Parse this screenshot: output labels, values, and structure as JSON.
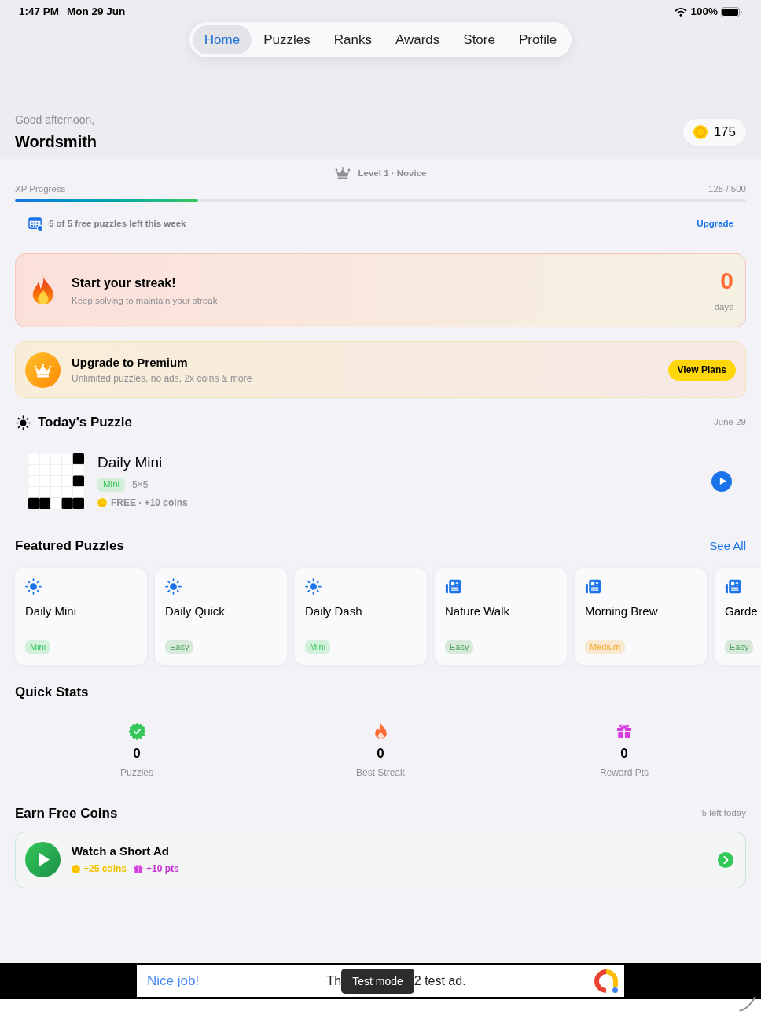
{
  "status_bar": {
    "time": "1:47 PM",
    "date": "Mon 29 Jun",
    "battery": "100%"
  },
  "tabs": [
    {
      "label": "Home",
      "selected": true
    },
    {
      "label": "Puzzles",
      "selected": false
    },
    {
      "label": "Ranks",
      "selected": false
    },
    {
      "label": "Awards",
      "selected": false
    },
    {
      "label": "Store",
      "selected": false
    },
    {
      "label": "Profile",
      "selected": false
    }
  ],
  "greeting": {
    "salutation": "Good afternoon,",
    "name": "Wordsmith",
    "coins": "175"
  },
  "rank": {
    "label": "Level 1 · Novice"
  },
  "xp": {
    "label": "XP Progress",
    "reading": "125 / 500",
    "level": 0.25
  },
  "free_puzzles": {
    "text": "5 of 5 free puzzles left this week",
    "action": "Upgrade"
  },
  "streak": {
    "title": "Start your streak!",
    "subtitle": "Keep solving to maintain your streak",
    "count": "0",
    "unit": "days"
  },
  "premium": {
    "title": "Upgrade to Premium",
    "subtitle": "Unlimited puzzles, no ads, 2x coins & more",
    "button": "View Plans"
  },
  "todays_puzzle": {
    "heading": "Today's Puzzle",
    "date": "June 29",
    "title": "Daily Mini",
    "tag": "Mini",
    "size": "5×5",
    "reward": "FREE · +10 coins"
  },
  "featured": {
    "heading": "Featured Puzzles",
    "action": "See All",
    "items": [
      {
        "kind": "daily",
        "title": "Daily Mini",
        "tag": "Mini",
        "color": "#34c759"
      },
      {
        "kind": "daily",
        "title": "Daily Quick",
        "tag": "Easy",
        "color": "#4fa35c"
      },
      {
        "kind": "daily",
        "title": "Daily Dash",
        "tag": "Mini",
        "color": "#34c759"
      },
      {
        "kind": "themed",
        "title": "Nature Walk",
        "tag": "Easy",
        "color": "#4fa35c"
      },
      {
        "kind": "themed",
        "title": "Morning Brew",
        "tag": "Medium",
        "color": "#f5a623"
      },
      {
        "kind": "themed",
        "title": "Garde",
        "tag": "Easy",
        "color": "#4fa35c"
      }
    ]
  },
  "quick_stats": {
    "heading": "Quick Stats",
    "items": [
      {
        "kind": "solved",
        "value": "0",
        "label": "Puzzles"
      },
      {
        "kind": "streak",
        "value": "0",
        "label": "Best Streak"
      },
      {
        "kind": "reward",
        "value": "0",
        "label": "Reward Pts"
      }
    ]
  },
  "earn_coins": {
    "heading": "Earn Free Coins",
    "remaining": "5 left today",
    "offer": {
      "title": "Watch a Short Ad",
      "coins": "+25 coins",
      "points": "+10 pts"
    }
  },
  "ad_banner": {
    "headline": "Nice job!",
    "text_start": "Th",
    "badge": "Test mode",
    "text_end": "2 test ad."
  }
}
